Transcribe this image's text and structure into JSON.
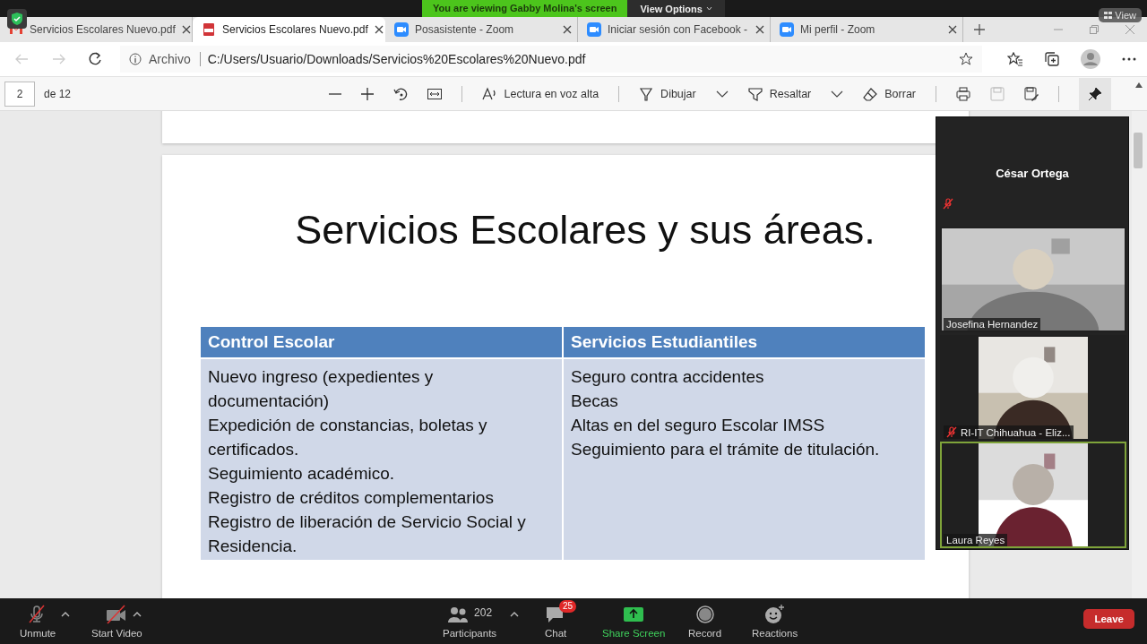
{
  "zoom_banner": {
    "text": "You are viewing Gabby Molina's screen",
    "view_options": "View Options",
    "view": "View"
  },
  "browser": {
    "tabs": [
      {
        "title": "Servicios Escolares Nuevo.pdf",
        "kind": "mail",
        "selected": false
      },
      {
        "title": "Servicios Escolares Nuevo.pdf",
        "kind": "pdf",
        "selected": true
      },
      {
        "title": "Posasistente - Zoom",
        "kind": "zoom",
        "selected": false
      },
      {
        "title": "Iniciar sesión con Facebook -",
        "kind": "zoom",
        "selected": false
      },
      {
        "title": "Mi perfil - Zoom",
        "kind": "zoom",
        "selected": false
      }
    ],
    "address": {
      "prefix": "Archivo",
      "url": "C:/Users/Usuario/Downloads/Servicios%20Escolares%20Nuevo.pdf"
    }
  },
  "pdf_toolbar": {
    "page": "2",
    "total": "de 12",
    "tools": [
      {
        "label": "Lectura en voz alta",
        "kind": "read",
        "dropdown": false
      },
      {
        "label": "Dibujar",
        "kind": "draw",
        "dropdown": true
      },
      {
        "label": "Resaltar",
        "kind": "highlight",
        "dropdown": true
      },
      {
        "label": "Borrar",
        "kind": "erase",
        "dropdown": false
      }
    ]
  },
  "slide": {
    "title": "Servicios Escolares y sus áreas.",
    "columns": [
      "Control Escolar",
      "Servicios Estudiantiles"
    ],
    "cells": [
      [
        "Nuevo ingreso (expedientes y documentación)",
        "Expedición de constancias, boletas y certificados.",
        "Seguimiento académico.",
        "Registro de créditos complementarios",
        "Registro de liberación de Servicio Social y Residencia."
      ],
      [
        "Seguro contra accidentes",
        "Becas",
        "Altas en del seguro Escolar IMSS",
        "Seguimiento para el trámite de titulación."
      ]
    ]
  },
  "participants": [
    {
      "name": "César Ortega",
      "kind": "name-only",
      "muted": true,
      "active": false
    },
    {
      "name": "Josefina Hernandez",
      "kind": "video",
      "muted": false,
      "active": false
    },
    {
      "name": "RI-IT Chihuahua - Eliz...",
      "kind": "video",
      "muted": true,
      "active": false
    },
    {
      "name": "Laura Reyes",
      "kind": "video",
      "muted": false,
      "active": true
    }
  ],
  "controls": [
    {
      "label": "Unmute",
      "kind": "mic",
      "caret": true
    },
    {
      "label": "Start Video",
      "kind": "video",
      "caret": true
    },
    {
      "label": "Participants",
      "kind": "participants",
      "count": "202",
      "caret": true
    },
    {
      "label": "Chat",
      "kind": "chat",
      "badge": "25",
      "caret": false
    },
    {
      "label": "Share Screen",
      "kind": "share",
      "caret": false
    },
    {
      "label": "Record",
      "kind": "record",
      "caret": false
    },
    {
      "label": "Reactions",
      "kind": "reactions",
      "caret": false
    }
  ],
  "leave": "Leave"
}
